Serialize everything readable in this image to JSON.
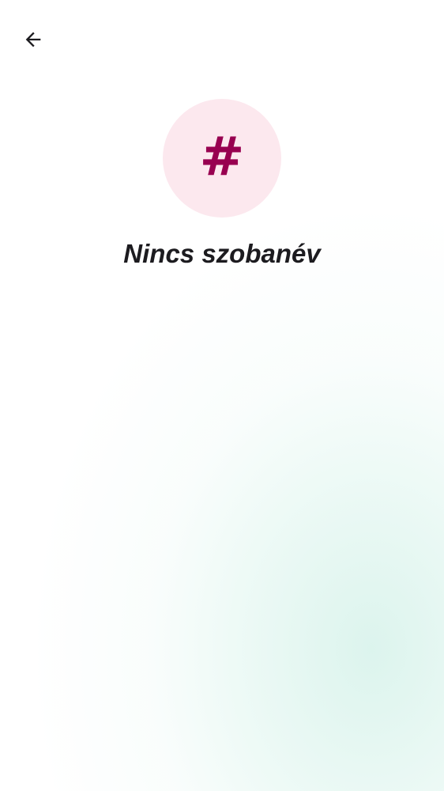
{
  "header": {
    "back_icon": "arrow-left-icon"
  },
  "room": {
    "avatar_glyph": "#",
    "name": "Nincs szobanév"
  },
  "colors": {
    "avatar_background": "#fce8ee",
    "avatar_glyph": "#980050",
    "icon": "#1c1b1f",
    "title_text": "#1c1b1f",
    "background_tint": "#dff5ee"
  }
}
